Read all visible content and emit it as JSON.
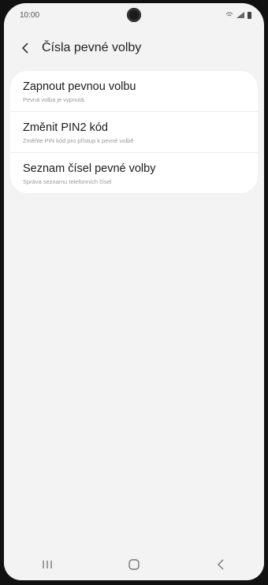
{
  "status_bar": {
    "time": "10:00"
  },
  "header": {
    "title": "Čísla pevné volby"
  },
  "settings": [
    {
      "title": "Zapnout pevnou volbu",
      "subtitle": "Pevná volba je vypnutá."
    },
    {
      "title": "Změnit PIN2 kód",
      "subtitle": "Změňte PIN kód pro přístup k pevné volbě"
    },
    {
      "title": "Seznam čísel pevné volby",
      "subtitle": "Správa seznamu telefonních čísel"
    }
  ],
  "colors": {
    "background": "#f3f3f3",
    "card": "#ffffff",
    "text_primary": "#1c1c1c",
    "text_secondary": "#9a9a9a"
  },
  "nav_icons": [
    "recent-apps-icon",
    "home-icon",
    "back-icon"
  ]
}
